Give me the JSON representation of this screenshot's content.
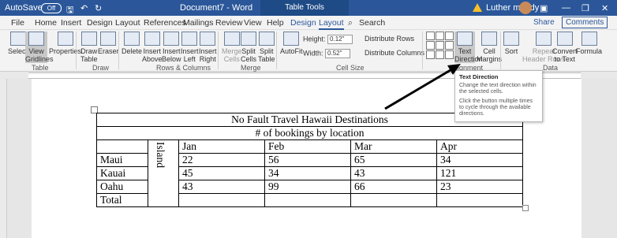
{
  "titlebar": {
    "autosave": "AutoSave",
    "toggle": "Off",
    "doc_title": "Document7 - Word",
    "contextual_tab": "Table Tools",
    "user": "Luther maddy"
  },
  "menu": {
    "tabs": [
      "File",
      "Home",
      "Insert",
      "Design",
      "Layout",
      "References",
      "Mailings",
      "Review",
      "View",
      "Help",
      "Design",
      "Layout"
    ],
    "search": "Search",
    "share": "Share",
    "comments": "Comments"
  },
  "ribbon": {
    "select": "Select",
    "view_gridlines": [
      "View",
      "Gridlines"
    ],
    "properties": "Properties",
    "draw_table": [
      "Draw",
      "Table"
    ],
    "eraser": "Eraser",
    "delete": "Delete",
    "insert_above": [
      "Insert",
      "Above"
    ],
    "insert_below": [
      "Insert",
      "Below"
    ],
    "insert_left": [
      "Insert",
      "Left"
    ],
    "insert_right": [
      "Insert",
      "Right"
    ],
    "merge_cells": [
      "Merge",
      "Cells"
    ],
    "split_cells": [
      "Split",
      "Cells"
    ],
    "split_table": [
      "Split",
      "Table"
    ],
    "autofit": "AutoFit",
    "height_label": "Height:",
    "height_value": "0.12\"",
    "width_label": "Width:",
    "width_value": "0.52\"",
    "distribute_rows": "Distribute Rows",
    "distribute_columns": "Distribute Columns",
    "text_direction": [
      "Text",
      "Direction"
    ],
    "cell_margins": [
      "Cell",
      "Margins"
    ],
    "sort": "Sort",
    "repeat_header": [
      "Repeat",
      "Header Rows"
    ],
    "convert": [
      "Convert",
      "to Text"
    ],
    "formula": "Formula",
    "groups": {
      "table": "Table",
      "draw": "Draw",
      "rows_columns": "Rows & Columns",
      "merge": "Merge",
      "cell_size": "Cell Size",
      "alignment": "Alignment",
      "data": "Data"
    }
  },
  "tooltip": {
    "title": "Text Direction",
    "line1": "Change the text direction within the selected cells.",
    "line2": "Click the button multiple times to cycle through the available directions."
  },
  "table": {
    "title": "No Fault Travel Hawaii Destinations",
    "subtitle": "# of bookings by location",
    "vertical_label": "Island",
    "months": [
      "Jan",
      "Feb",
      "Mar",
      "Apr"
    ],
    "rows": [
      {
        "label": "Maui",
        "values": [
          "22",
          "56",
          "65",
          "34"
        ]
      },
      {
        "label": "Kauai",
        "values": [
          "45",
          "34",
          "43",
          "121"
        ]
      },
      {
        "label": "Oahu",
        "values": [
          "43",
          "99",
          "66",
          "23"
        ]
      },
      {
        "label": "Total",
        "values": [
          "",
          "",
          "",
          ""
        ]
      }
    ]
  }
}
